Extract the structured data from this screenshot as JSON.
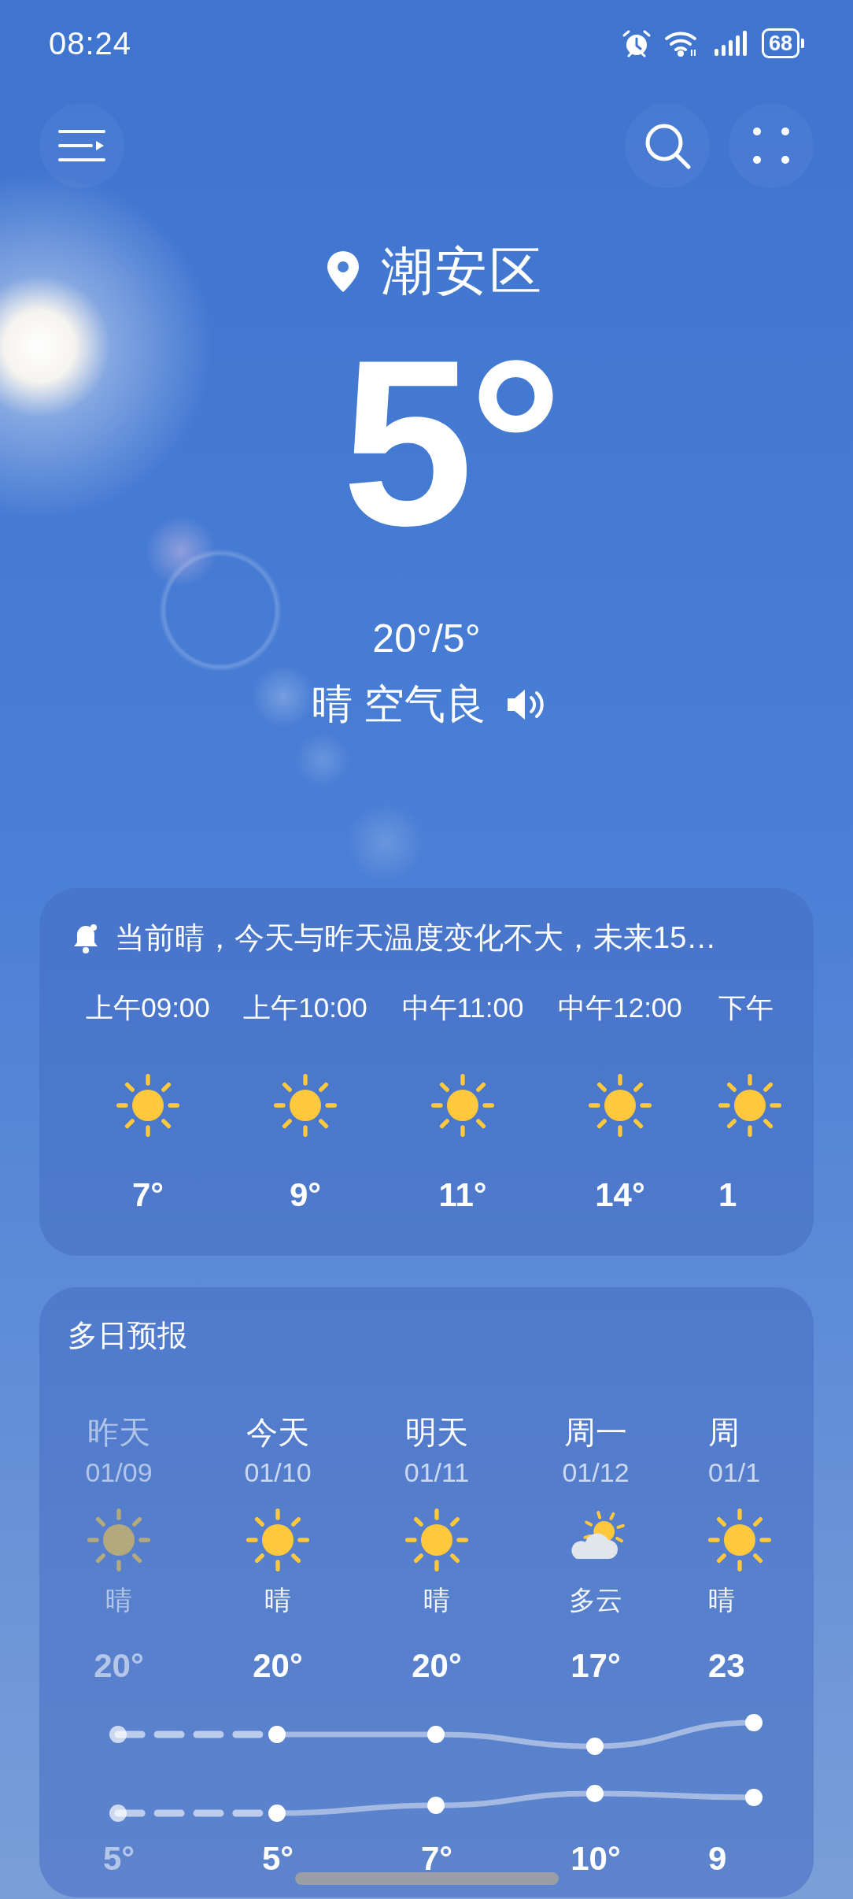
{
  "status_bar": {
    "time": "08:24",
    "battery": "68"
  },
  "location": "潮安区",
  "current": {
    "temperature": "5°",
    "range": "20°/5°",
    "summary": "晴 空气良"
  },
  "hourly": {
    "alert": "当前晴，今天与昨天温度变化不大，未来15…",
    "hours": [
      {
        "time": "上午09:00",
        "kind": "sunny",
        "temp": "7°"
      },
      {
        "time": "上午10:00",
        "kind": "sunny",
        "temp": "9°"
      },
      {
        "time": "中午11:00",
        "kind": "sunny",
        "temp": "11°"
      },
      {
        "time": "中午12:00",
        "kind": "sunny",
        "temp": "14°"
      },
      {
        "time": "下午",
        "kind": "sunny",
        "temp": "1"
      }
    ]
  },
  "daily": {
    "title": "多日预报",
    "days": [
      {
        "day": "昨天",
        "date": "01/09",
        "kind": "sunny",
        "weather": "晴",
        "high": "20°",
        "low": "5°",
        "past": true
      },
      {
        "day": "今天",
        "date": "01/10",
        "kind": "sunny",
        "weather": "晴",
        "high": "20°",
        "low": "5°",
        "past": false
      },
      {
        "day": "明天",
        "date": "01/11",
        "kind": "sunny",
        "weather": "晴",
        "high": "20°",
        "low": "7°",
        "past": false
      },
      {
        "day": "周一",
        "date": "01/12",
        "kind": "cloudy",
        "weather": "多云",
        "high": "17°",
        "low": "10°",
        "past": false
      },
      {
        "day": "周",
        "date": "01/1",
        "kind": "sunny",
        "weather": "晴",
        "high": "23",
        "low": "9",
        "past": false
      }
    ]
  }
}
